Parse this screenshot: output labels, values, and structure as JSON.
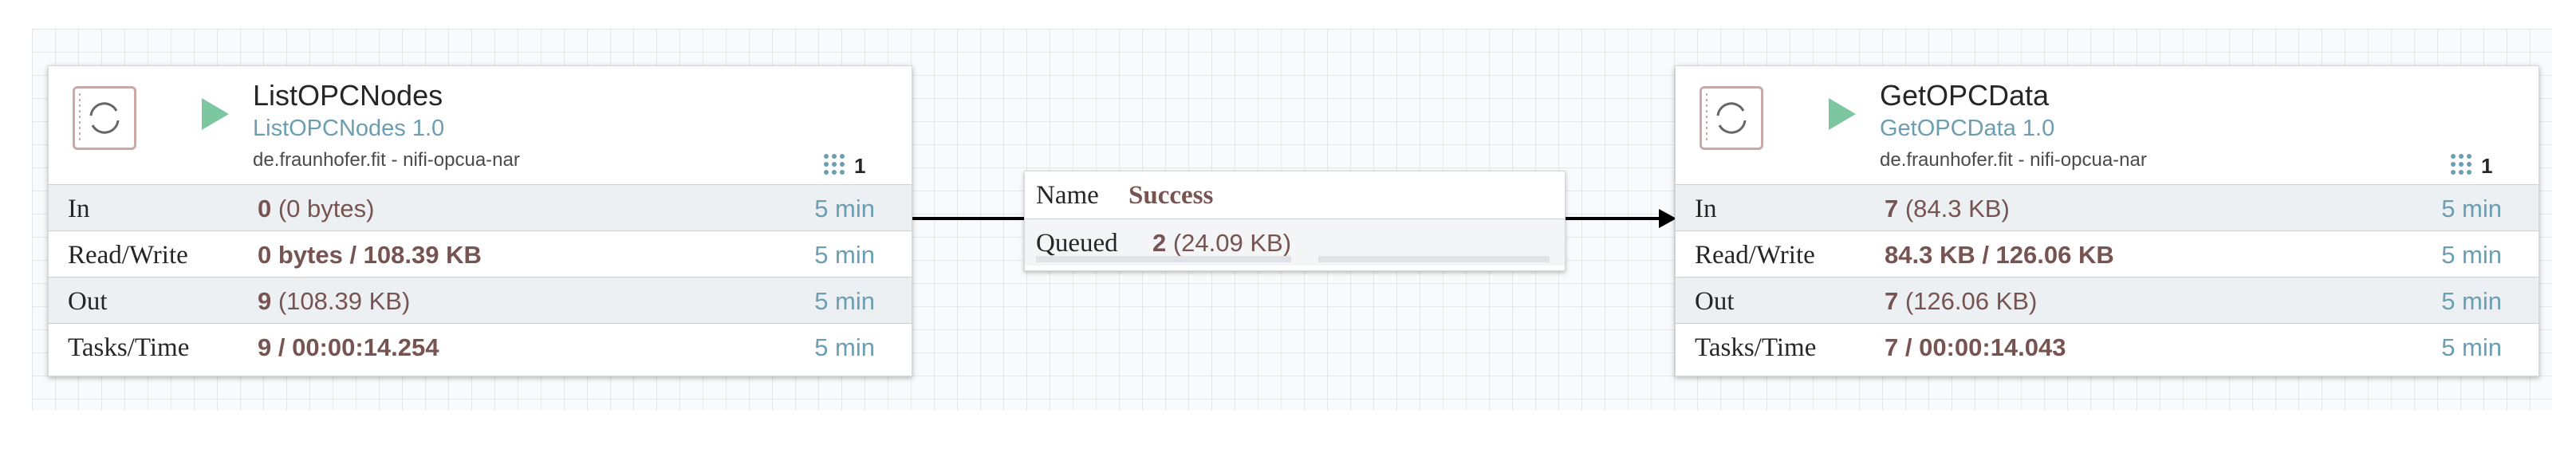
{
  "processors": [
    {
      "name": "ListOPCNodes",
      "type": "ListOPCNodes 1.0",
      "bundle": "de.fraunhofer.fit - nifi-opcua-nar",
      "active_threads": "1",
      "stats": {
        "in": {
          "label": "In",
          "value": "0",
          "detail": " (0 bytes)",
          "time": "5 min"
        },
        "rw": {
          "label": "Read/Write",
          "value": "0 bytes / 108.39 KB",
          "time": "5 min"
        },
        "out": {
          "label": "Out",
          "value": "9",
          "detail": " (108.39 KB)",
          "time": "5 min"
        },
        "tasks": {
          "label": "Tasks/Time",
          "value": "9 / 00:00:14.254",
          "time": "5 min"
        }
      }
    },
    {
      "name": "GetOPCData",
      "type": "GetOPCData 1.0",
      "bundle": "de.fraunhofer.fit - nifi-opcua-nar",
      "active_threads": "1",
      "stats": {
        "in": {
          "label": "In",
          "value": "7",
          "detail": " (84.3 KB)",
          "time": "5 min"
        },
        "rw": {
          "label": "Read/Write",
          "value": "84.3 KB / 126.06 KB",
          "time": "5 min"
        },
        "out": {
          "label": "Out",
          "value": "7",
          "detail": " (126.06 KB)",
          "time": "5 min"
        },
        "tasks": {
          "label": "Tasks/Time",
          "value": "7 / 00:00:14.043",
          "time": "5 min"
        }
      }
    }
  ],
  "connection": {
    "name_key": "Name",
    "name_value": "Success",
    "queued_key": "Queued",
    "queued_value": "2",
    "queued_detail": " (24.09 KB)"
  },
  "icons": {
    "processor": "processor-icon",
    "run_state": "play-icon",
    "thread_count": "threads-icon",
    "arrow": "arrow-right-icon"
  },
  "colors": {
    "running": "#7dc7a0",
    "stat_value": "#775351",
    "link": "#6b9eb2"
  }
}
